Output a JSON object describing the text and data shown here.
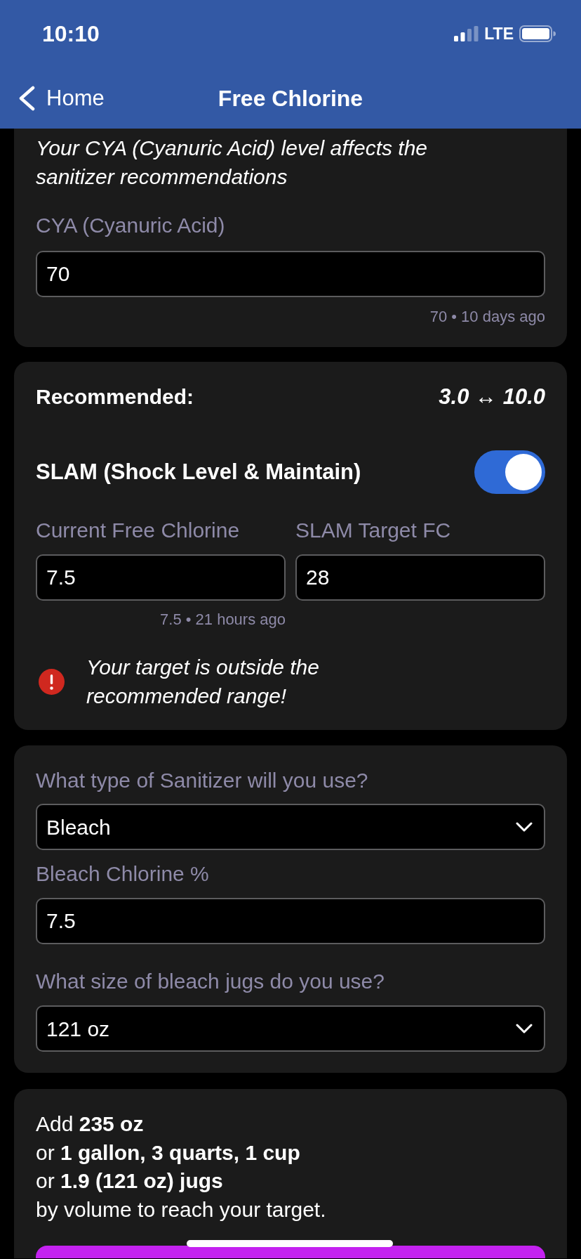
{
  "status_bar": {
    "time": "10:10",
    "network": "LTE"
  },
  "nav_bar": {
    "back_label": "Home",
    "title": "Free Chlorine"
  },
  "cya_card": {
    "note": "Your CYA (Cyanuric Acid) level affects the sanitizer recommendations",
    "field": {
      "label": "CYA (Cyanuric Acid)",
      "value": "70",
      "history": "70 • 10 days ago"
    }
  },
  "target_card": {
    "recommended_label": "Recommended:",
    "recommended_range": "3.0 ↔ 10.0",
    "slam": {
      "label": "SLAM (Shock Level & Maintain)",
      "on": true
    },
    "fields": [
      {
        "label": "Current Free Chlorine",
        "value": "7.5",
        "history": "7.5 • 21 hours ago"
      },
      {
        "label": "SLAM Target FC",
        "value": "28"
      }
    ],
    "warning": "Your target is outside the recommended range!"
  },
  "sanitizer_card": {
    "fields": [
      {
        "kind": "select",
        "label": "What type of Sanitizer will you use?",
        "value": "Bleach"
      },
      {
        "kind": "input",
        "label": "Bleach Chlorine %",
        "value": "7.5"
      },
      {
        "kind": "select",
        "label": "What size of bleach jugs do you use?",
        "value": "121 oz"
      }
    ]
  },
  "result_card": {
    "lines": [
      "Add **235 oz**",
      "or **1 gallon, 3 quarts, 1 cup**",
      "or **1.9 (121 oz) jugs**",
      "by volume to reach your target."
    ]
  }
}
